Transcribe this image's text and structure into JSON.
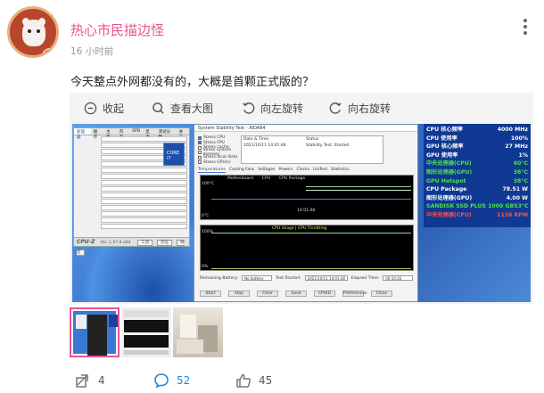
{
  "post": {
    "username": "热心市民描边怪",
    "time": "16 小时前",
    "text": "今天整点外网都没有的，大概是首颗正式版的？",
    "avatar_badge": "大",
    "accent_color": "#e8538f"
  },
  "viewer_toolbar": {
    "collapse": "收起",
    "view_large": "查看大图",
    "rotate_left": "向左旋转",
    "rotate_right": "向右旋转"
  },
  "cpuz": {
    "tabs": [
      "处理器",
      "缓存",
      "主板",
      "内存",
      "SPD",
      "显卡",
      "测试分数",
      "关于"
    ],
    "logo_text": "CORE i7",
    "footer_brand": "CPU-Z",
    "footer_version": "Ver. 1.97.0.x64",
    "footer_tools": "工具",
    "footer_validate": "验证",
    "footer_ok": "确定"
  },
  "aida": {
    "title": "System Stability Test - AIDA64",
    "checks": [
      "Stress CPU",
      "Stress FPU",
      "Stress cache",
      "Stress system memory",
      "Stress local disks",
      "Stress GPU(s)"
    ],
    "col_date": "Date & Time",
    "col_status": "Status",
    "row_date": "2021/10/11 14:01:48",
    "row_status": "Stability Test: Started",
    "tabs": [
      "Temperatures",
      "Cooling Fans",
      "Voltages",
      "Powers",
      "Clocks",
      "Unified",
      "Statistics"
    ],
    "graph1_legend": [
      "Motherboard",
      "CPU",
      "CPU Package"
    ],
    "graph1_top": "100°C",
    "graph1_bottom": "0°C",
    "graph1_time": "14:01:48",
    "graph2_title": "CPU Usage | CPU Throttling",
    "graph2_top": "100%",
    "graph2_bottom": "0%",
    "remaining_label": "Remaining Battery:",
    "remaining_value": "No battery",
    "started_label": "Test Started:",
    "started_value": "2021/10/11 14:01:48",
    "elapsed_label": "Elapsed Time:",
    "elapsed_value": "00:10:26",
    "buttons": [
      "Start",
      "Stop",
      "Clear",
      "Save",
      "CPUID",
      "Preferences",
      "Close"
    ]
  },
  "osd": [
    {
      "label": "CPU 核心频率",
      "value": "4000 MHz",
      "color": "#ffffff"
    },
    {
      "label": "CPU 使用率",
      "value": "100%",
      "color": "#ffffff"
    },
    {
      "label": "GPU 核心频率",
      "value": "27 MHz",
      "color": "#ffffff"
    },
    {
      "label": "GPU 使用率",
      "value": "1%",
      "color": "#ffffff"
    },
    {
      "label": "中央处理器(CPU)",
      "value": "60°C",
      "color": "#4fe04f"
    },
    {
      "label": "图形处理器(GPU)",
      "value": "38°C",
      "color": "#4fe04f"
    },
    {
      "label": "GPU Hotspot",
      "value": "38°C",
      "color": "#4fe04f"
    },
    {
      "label": "CPU Package",
      "value": "78.51 W",
      "color": "#ffffff"
    },
    {
      "label": "图形处理器(GPU)",
      "value": "4.00 W",
      "color": "#ffffff"
    },
    {
      "label": "SANDISK SSD PLUS 1000 GB",
      "value": "53°C",
      "color": "#4fe04f"
    },
    {
      "label": "中央处理器(CPU)",
      "value": "1136 RPM",
      "color": "#ff5050"
    }
  ],
  "actions": {
    "repost_count": "4",
    "comment_count": "52",
    "like_count": "45",
    "icon_color": "#1e88d8"
  }
}
